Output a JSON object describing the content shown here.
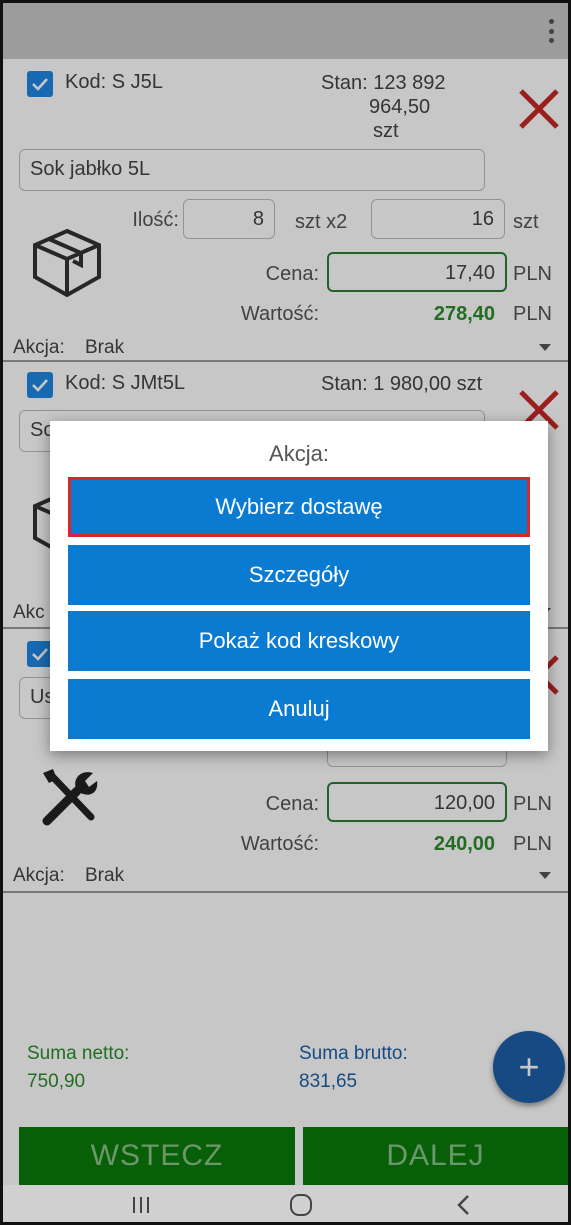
{
  "colors": {
    "accent": "#0a7bd0",
    "green_button": "#0a7a0a",
    "delete_red": "#c62828",
    "selection_border": "#d62828"
  },
  "items": [
    {
      "kod": "Kod: S J5L",
      "stan_line1": "Stan: 123 892",
      "stan_line2": "964,50",
      "stan_line3": "szt",
      "name": "Sok jabłko 5L",
      "ilosc_label": "Ilość:",
      "ilosc_value": "8",
      "mult_label": "szt x2",
      "total_qty": "16",
      "total_unit": "szt",
      "cena_label": "Cena:",
      "cena_value": "17,40",
      "cena_unit": "PLN",
      "wartosc_label": "Wartość:",
      "wartosc_value": "278,40",
      "wartosc_unit": "PLN",
      "akcja_label": "Akcja:",
      "akcja_value": "Brak",
      "icon": "box-icon"
    },
    {
      "kod": "Kod: S JMt5L",
      "stan_line1": "Stan: 1 980,00 szt",
      "name": "So",
      "akcja_label": "Akc",
      "icon": "box-icon"
    },
    {
      "name": "Us",
      "cena_label": "Cena:",
      "cena_value": "120,00",
      "cena_unit": "PLN",
      "wartosc_label": "Wartość:",
      "wartosc_value": "240,00",
      "wartosc_unit": "PLN",
      "akcja_label": "Akcja:",
      "akcja_value": "Brak",
      "icon": "tools-icon"
    }
  ],
  "summary": {
    "netto_label": "Suma netto:",
    "netto_value": "750,90",
    "brutto_label": "Suma brutto:",
    "brutto_value": "831,65"
  },
  "fab": {
    "label": "+"
  },
  "buttons": {
    "back": "WSTECZ",
    "next": "DALEJ"
  },
  "dialog": {
    "title": "Akcja:",
    "options": [
      "Wybierz dostawę",
      "Szczegóły",
      "Pokaż kod kreskowy",
      "Anuluj"
    ]
  }
}
